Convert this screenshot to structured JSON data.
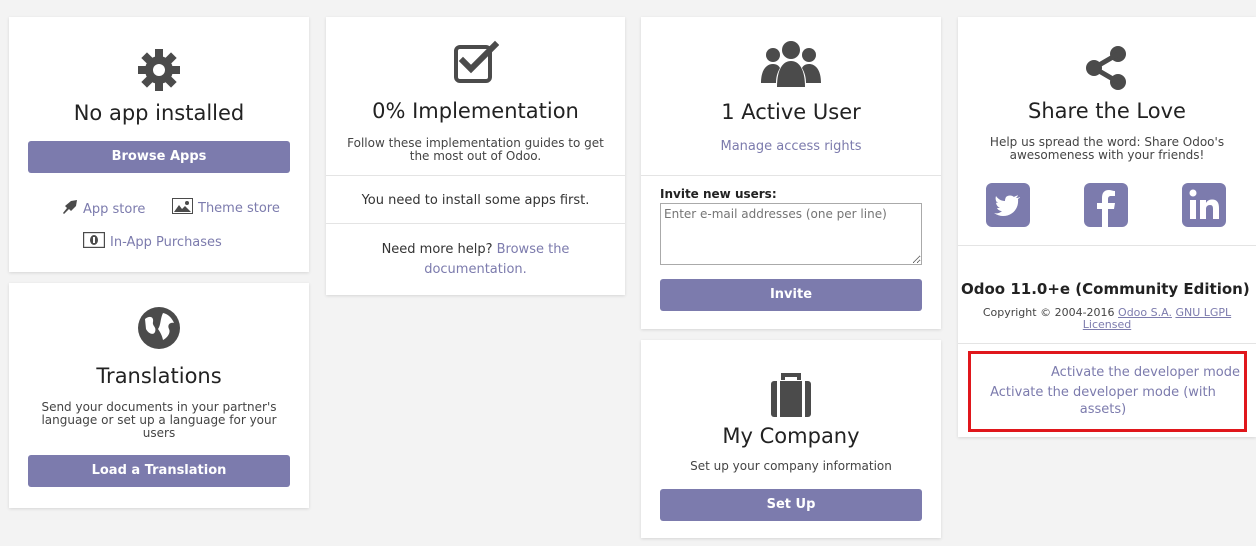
{
  "apps": {
    "title": "No app installed",
    "browse_label": "Browse Apps",
    "app_store_label": "App store",
    "theme_store_label": "Theme store",
    "inapp_label": "In-App Purchases"
  },
  "translations": {
    "title": "Translations",
    "description": "Send your documents in your partner's language or set up a language for your users",
    "button_label": "Load a Translation"
  },
  "implementation": {
    "title": "0% Implementation",
    "description": "Follow these implementation guides to get the most out of Odoo.",
    "need_apps": "You need to install some apps first.",
    "help_prefix": "Need more help?",
    "help_link": "Browse the documentation."
  },
  "users": {
    "title": "1 Active User",
    "manage_link": "Manage access rights",
    "invite_label": "Invite new users:",
    "invite_placeholder": "Enter e-mail addresses (one per line)",
    "invite_button": "Invite"
  },
  "company": {
    "title": "My Company",
    "description": "Set up your company information",
    "button_label": "Set Up"
  },
  "share": {
    "title": "Share the Love",
    "description": "Help us spread the word: Share Odoo's awesomeness with your friends!",
    "version": "Odoo 11.0+e (Community Edition)",
    "copyright_prefix": "Copyright © 2004-2016",
    "odoo_link": "Odoo S.A.",
    "license_link": "GNU LGPL Licensed",
    "dev_mode": "Activate the developer mode",
    "dev_mode_assets": "Activate the developer mode (with assets)"
  },
  "colors": {
    "accent": "#7c7bad",
    "highlight": "#e0171c"
  }
}
